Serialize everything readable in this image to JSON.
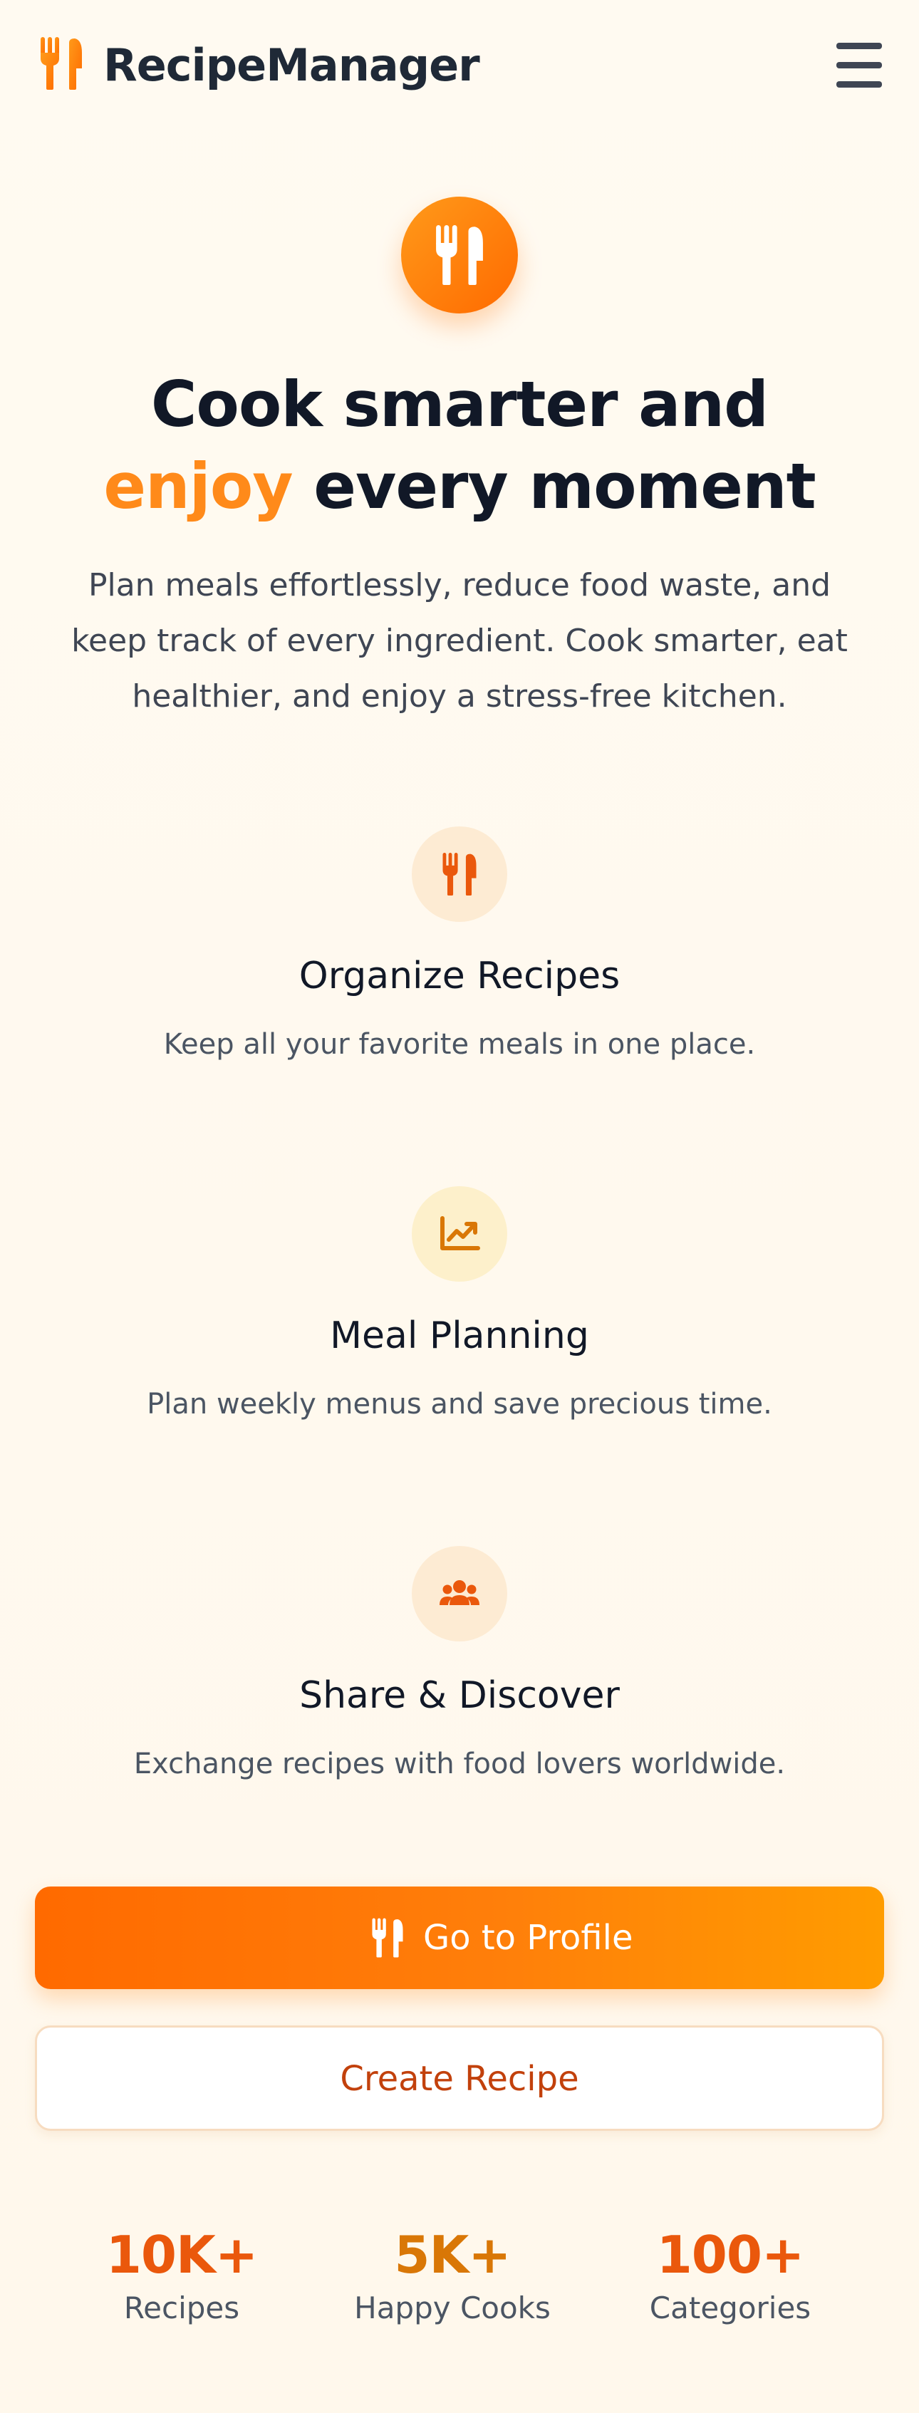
{
  "header": {
    "app_name": "RecipeManager",
    "logo_icon": "utensils-icon",
    "menu_icon": "hamburger-menu-icon"
  },
  "hero": {
    "icon": "utensils-icon",
    "title_line1": "Cook smarter and",
    "title_accent": "enjoy",
    "title_rest": " every moment",
    "description": "Plan meals effortlessly, reduce food waste, and keep track of every ingredient. Cook smarter, eat healthier, and enjoy a stress-free kitchen."
  },
  "features": [
    {
      "icon": "utensils-icon",
      "title": "Organize Recipes",
      "description": "Keep all your favorite meals in one place."
    },
    {
      "icon": "trend-chart-icon",
      "title": "Meal Planning",
      "description": "Plan weekly menus and save precious time."
    },
    {
      "icon": "users-icon",
      "title": "Share & Discover",
      "description": "Exchange recipes with food lovers worldwide."
    }
  ],
  "actions": {
    "primary_label": "Go to Profile",
    "primary_icon": "utensils-icon",
    "secondary_label": "Create Recipe"
  },
  "stats": [
    {
      "value": "10K+",
      "label": "Recipes",
      "color": "#ea580c"
    },
    {
      "value": "5K+",
      "label": "Happy Cooks",
      "color": "#d97706"
    },
    {
      "value": "100+",
      "label": "Categories",
      "color": "#ea580c"
    }
  ],
  "colors": {
    "accent": "#ff8a1a",
    "primary_gradient_start": "#ff6a00",
    "primary_gradient_end": "#ff9c00",
    "secondary_text": "#c2410c"
  }
}
